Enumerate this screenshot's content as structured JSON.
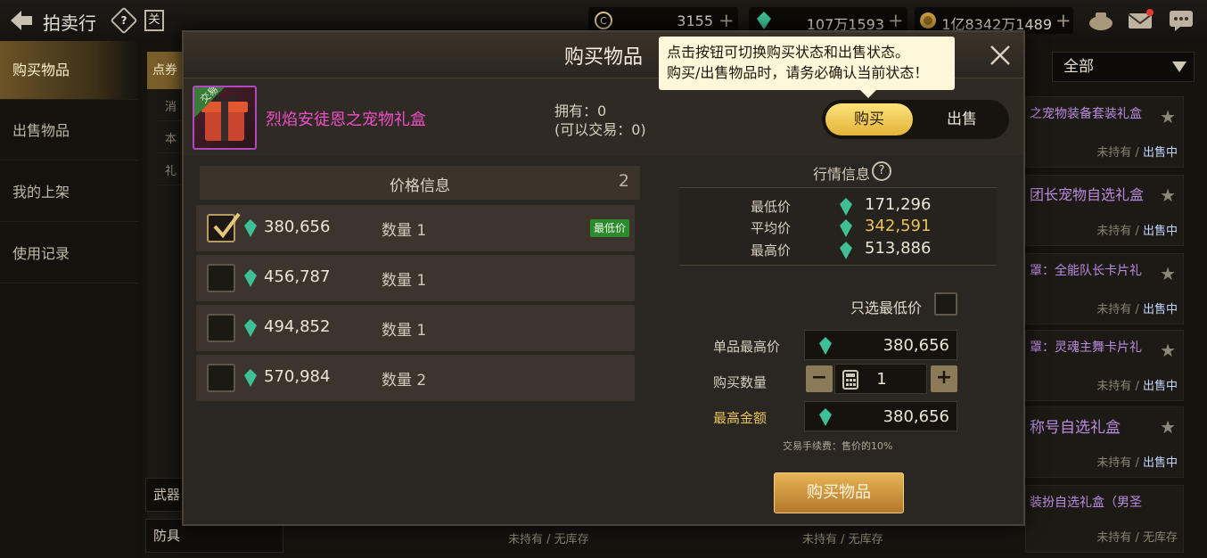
{
  "topbar": {
    "title": "拍卖行",
    "help_glyph": "?",
    "extra_glyph": "关",
    "currencies": [
      {
        "name": "c-coin-icon",
        "value": "3155"
      },
      {
        "name": "gem-icon",
        "value": "107万1593"
      },
      {
        "name": "gold-coin-icon",
        "value": "1亿8342万1489"
      }
    ],
    "plus": "+"
  },
  "leftnav": {
    "items": [
      {
        "label": "购买物品",
        "active": true
      },
      {
        "label": "出售物品",
        "active": false
      },
      {
        "label": "我的上架",
        "active": false
      },
      {
        "label": "使用记录",
        "active": false
      }
    ]
  },
  "background": {
    "category_tab": "点券",
    "category_lines": [
      "消",
      "本",
      "礼",
      "•",
      "•",
      "•",
      "•",
      "•",
      "•",
      "•",
      "•",
      "•"
    ],
    "bottom_categories": [
      "武器",
      "防具"
    ],
    "filter": "全部",
    "cards": [
      {
        "title": "之宠物装备套装礼盒",
        "owned": "未持有",
        "status": "出售中"
      },
      {
        "title": "团长宠物自选礼盒",
        "owned": "未持有",
        "status": "出售中"
      },
      {
        "title": "罩：全能队长卡片礼",
        "owned": "未持有",
        "status": "出售中"
      },
      {
        "title": "罩：灵魂主舞卡片礼",
        "owned": "未持有",
        "status": "出售中"
      },
      {
        "title": "称号自选礼盒",
        "owned": "未持有",
        "status": "出售中"
      },
      {
        "title": "装扮自选礼盒（男圣",
        "owned": "未持有",
        "status": "无库存"
      }
    ],
    "bottom_status": [
      {
        "owned": "未持有",
        "status": "无库存"
      },
      {
        "owned": "未持有",
        "status": "无库存"
      }
    ]
  },
  "modal": {
    "title": "购买物品",
    "tooltip_line1": "点击按钮可切换购买状态和出售状态。",
    "tooltip_line2": "购买/出售物品时，请务必确认当前状态！",
    "item": {
      "name": "烈焰安徒恩之宠物礼盒",
      "badge": "交易",
      "owned_line1": "拥有：0",
      "owned_line2": "(可以交易：0)"
    },
    "toggle": {
      "buy": "购买",
      "sell": "出售",
      "selected": "buy"
    },
    "price_info": {
      "title": "价格信息",
      "count": "2",
      "rows": [
        {
          "price": "380,656",
          "qty": "数量 1",
          "checked": true,
          "badge": "最低价"
        },
        {
          "price": "456,787",
          "qty": "数量 1",
          "checked": false,
          "badge": ""
        },
        {
          "price": "494,852",
          "qty": "数量 1",
          "checked": false,
          "badge": ""
        },
        {
          "price": "570,984",
          "qty": "数量 2",
          "checked": false,
          "badge": ""
        }
      ]
    },
    "market": {
      "title": "行情信息",
      "info_glyph": "?",
      "min_label": "最低价",
      "min_value": "171,296",
      "avg_label": "平均价",
      "avg_value": "342,591",
      "max_label": "最高价",
      "max_value": "513,886"
    },
    "lowest_only_label": "只选最低价",
    "form": {
      "max_unit_label": "单品最高价",
      "max_unit_value": "380,656",
      "qty_label": "购买数量",
      "qty_value": "1",
      "minus": "−",
      "plus": "+",
      "max_total_label": "最高金额",
      "max_total_value": "380,656",
      "fee_note": "交易手续费：售价的10%"
    },
    "buy_button": "购买物品"
  },
  "colors": {
    "accent_gold": "#e8c35a",
    "item_name": "#f04ec8",
    "lowest_badge": "#2d8a2f",
    "button_gold": "#d39c45"
  }
}
